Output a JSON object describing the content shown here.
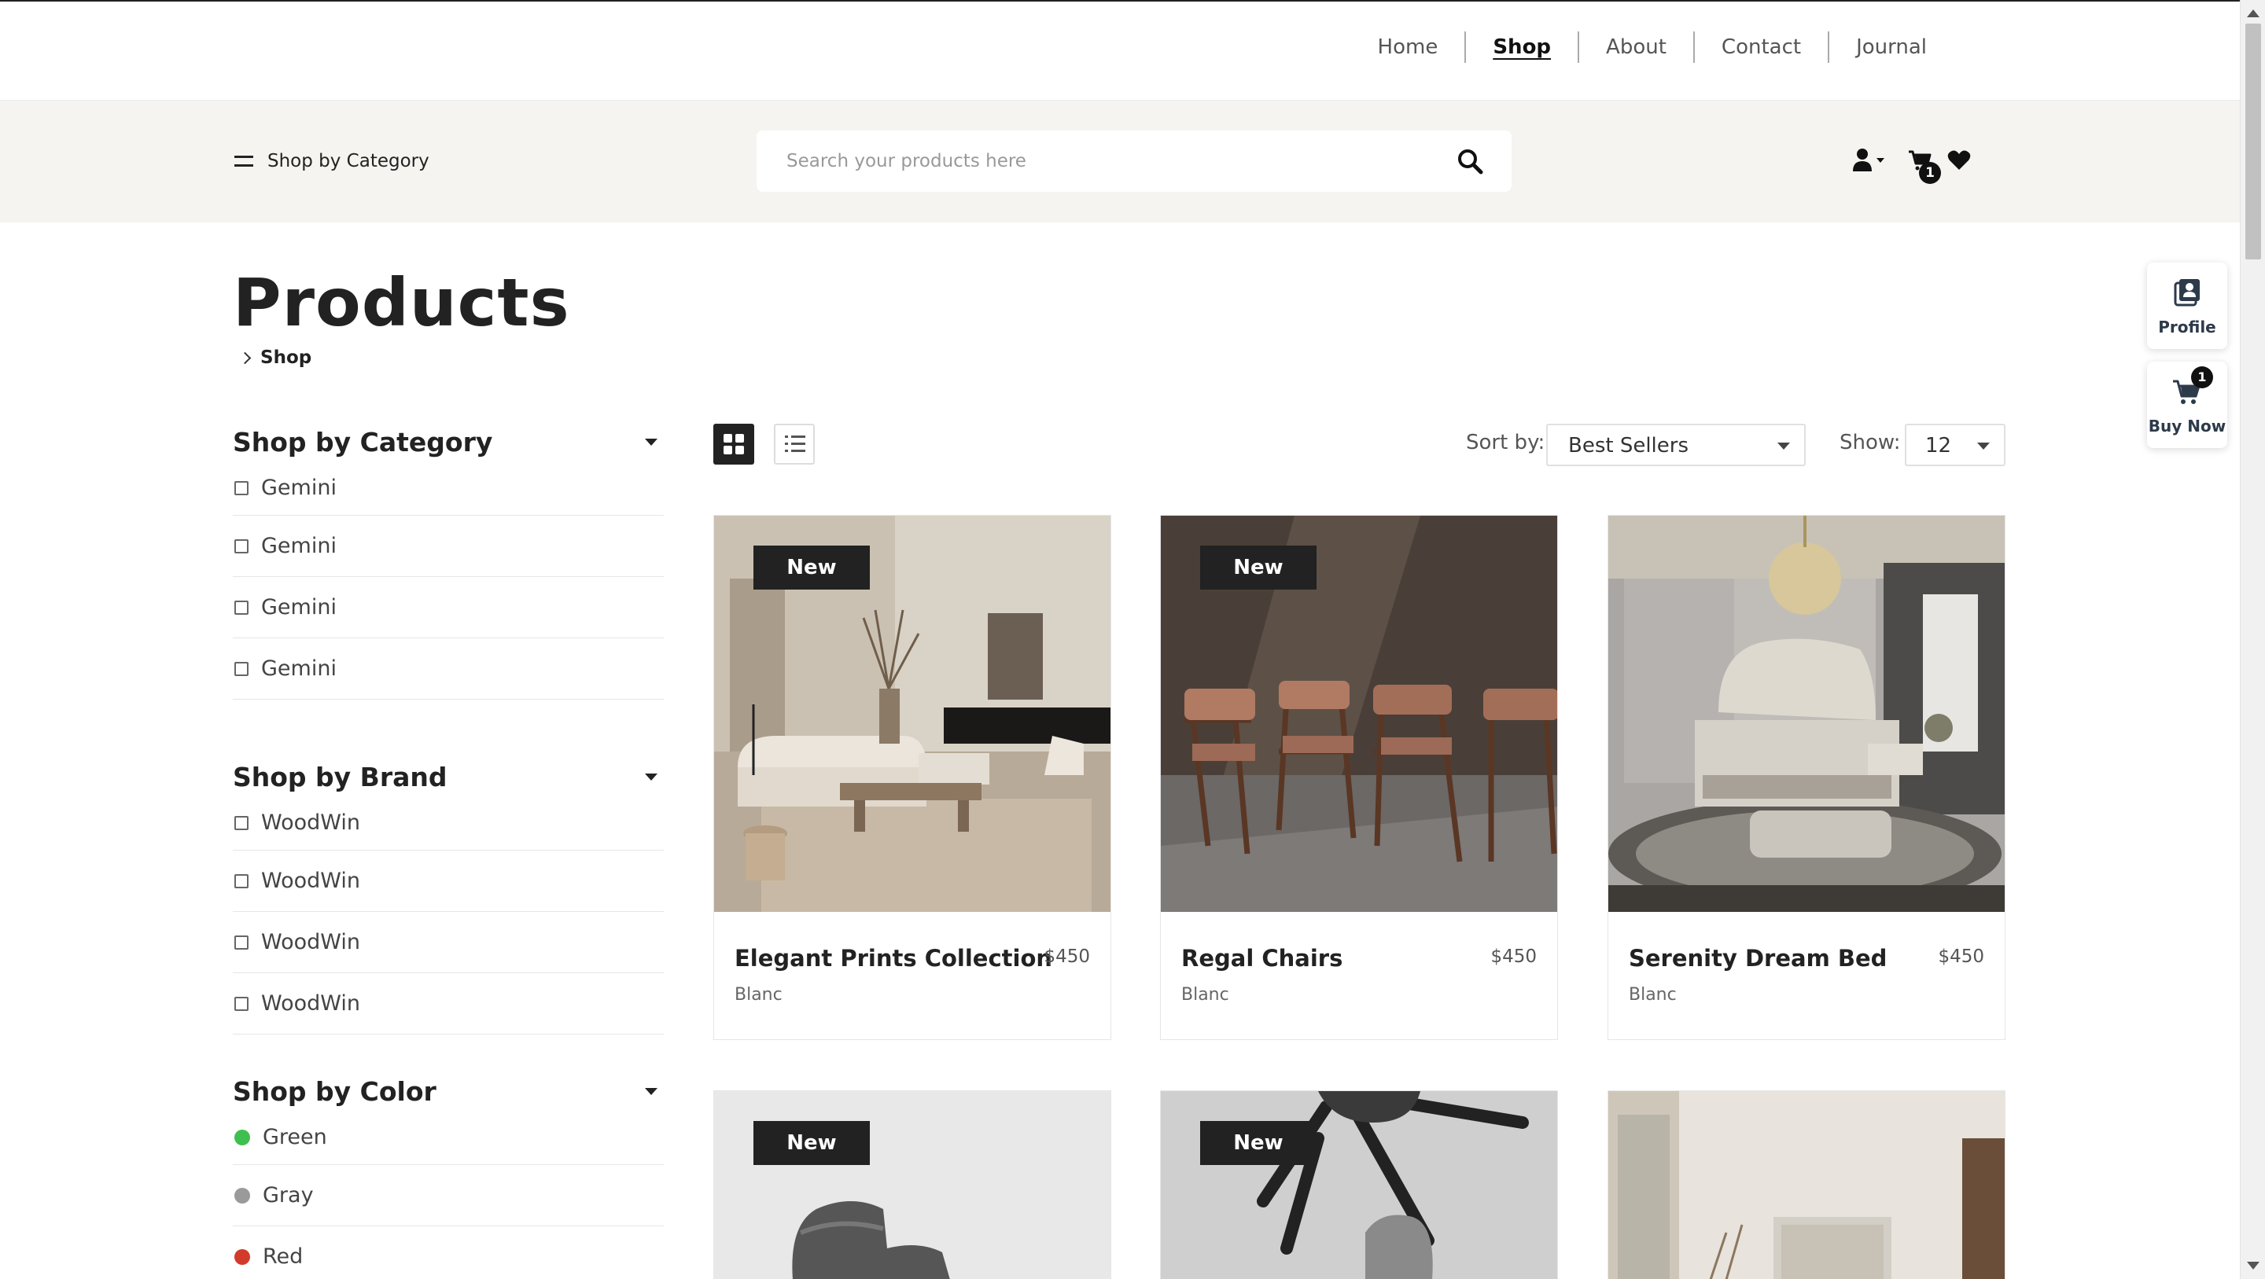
{
  "nav": {
    "items": [
      {
        "label": "Home",
        "active": false
      },
      {
        "label": "Shop",
        "active": true
      },
      {
        "label": "About",
        "active": false
      },
      {
        "label": "Contact",
        "active": false
      },
      {
        "label": "Journal",
        "active": false
      }
    ]
  },
  "header": {
    "category_button": "Shop by Category",
    "search_placeholder": "Search your products here",
    "cart_count": "1"
  },
  "page": {
    "title": "Products",
    "breadcrumb": "Shop"
  },
  "sidebar": {
    "category": {
      "title": "Shop by Category",
      "items": [
        "Gemini",
        "Gemini",
        "Gemini",
        "Gemini"
      ]
    },
    "brand": {
      "title": "Shop by Brand",
      "items": [
        "WoodWin",
        "WoodWin",
        "WoodWin",
        "WoodWin"
      ]
    },
    "color": {
      "title": "Shop by Color",
      "items": [
        {
          "label": "Green",
          "color": "#3fbf4f"
        },
        {
          "label": "Gray",
          "color": "#9a9a9a"
        },
        {
          "label": "Red",
          "color": "#d23b2b"
        }
      ]
    }
  },
  "toolbar": {
    "sort_label": "Sort by:",
    "sort_value": "Best Sellers",
    "show_label": "Show:",
    "show_value": "12"
  },
  "products": [
    {
      "name": "Elegant Prints Collection",
      "price": "$450",
      "brand": "Blanc",
      "badge": "New"
    },
    {
      "name": "Regal Chairs",
      "price": "$450",
      "brand": "Blanc",
      "badge": "New"
    },
    {
      "name": "Serenity Dream Bed",
      "price": "$450",
      "brand": "Blanc",
      "badge": ""
    },
    {
      "name": "",
      "price": "",
      "brand": "",
      "badge": "New"
    },
    {
      "name": "",
      "price": "",
      "brand": "",
      "badge": "New"
    },
    {
      "name": "",
      "price": "",
      "brand": "",
      "badge": ""
    }
  ],
  "floating": {
    "profile_label": "Profile",
    "buy_label": "Buy Now",
    "buy_count": "1"
  }
}
